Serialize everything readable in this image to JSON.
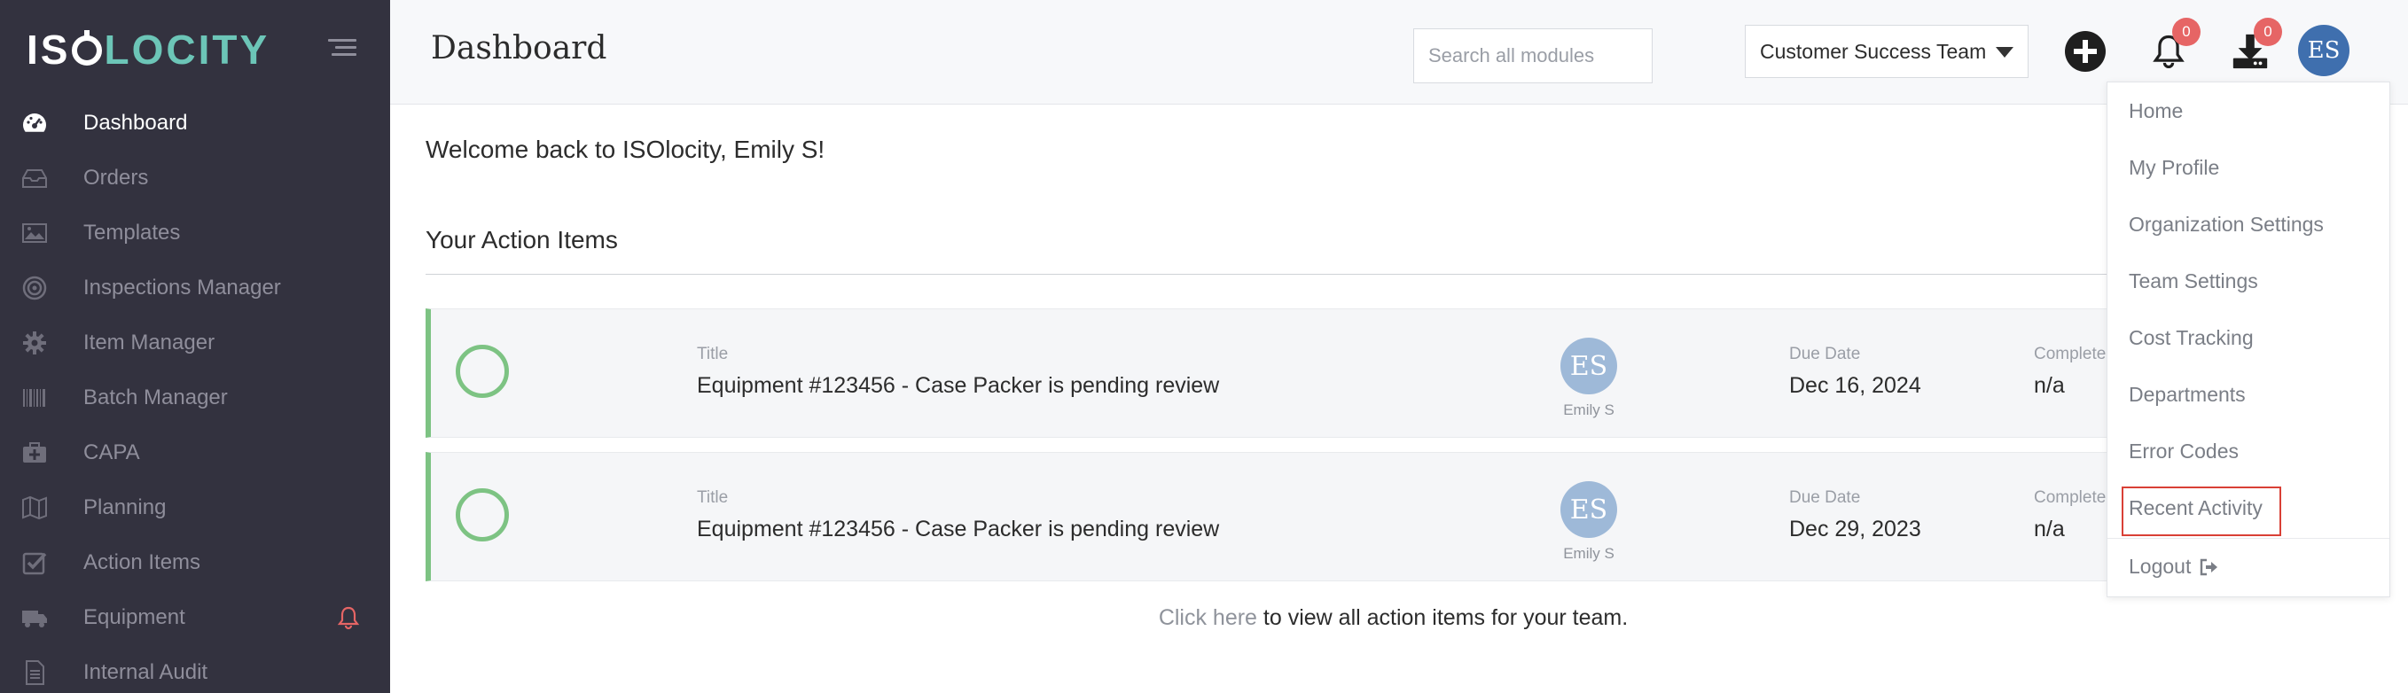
{
  "app": {
    "logo_iso": "IS",
    "logo_locity": "LOCITY"
  },
  "sidebar": {
    "items": [
      {
        "label": "Dashboard",
        "icon": "dashboard-gauge-icon",
        "active": true
      },
      {
        "label": "Orders",
        "icon": "inbox-icon"
      },
      {
        "label": "Templates",
        "icon": "image-icon"
      },
      {
        "label": "Inspections Manager",
        "icon": "target-icon"
      },
      {
        "label": "Item Manager",
        "icon": "gear-icon"
      },
      {
        "label": "Batch Manager",
        "icon": "barcode-icon"
      },
      {
        "label": "CAPA",
        "icon": "medical-kit-icon"
      },
      {
        "label": "Planning",
        "icon": "map-icon"
      },
      {
        "label": "Action Items",
        "icon": "checkbox-icon"
      },
      {
        "label": "Equipment",
        "icon": "truck-icon"
      },
      {
        "label": "Internal Audit",
        "icon": "document-icon"
      }
    ]
  },
  "header": {
    "title": "Dashboard",
    "search_placeholder": "Search all modules",
    "team": "Customer Success Team",
    "notifications_count": "0",
    "downloads_count": "0",
    "avatar_initials": "ES"
  },
  "main": {
    "welcome": "Welcome back to ISOlocity, Emily S!",
    "section_title": "Your Action Items",
    "action_items": [
      {
        "title_label": "Title",
        "title": "Equipment #123456 - Case Packer is pending review",
        "avatar_initials": "ES",
        "assignee": "Emily S",
        "due_label": "Due Date",
        "due": "Dec 16, 2024",
        "completed_label": "Completed Date",
        "completed": "n/a"
      },
      {
        "title_label": "Title",
        "title": "Equipment #123456 - Case Packer is pending review",
        "avatar_initials": "ES",
        "assignee": "Emily S",
        "due_label": "Due Date",
        "due": "Dec 29, 2023",
        "completed_label": "Completed Date",
        "completed": "n/a"
      }
    ],
    "footer_link": "Click here",
    "footer_text": " to view all action items for your team."
  },
  "dropdown": {
    "items": [
      "Home",
      "My Profile",
      "Organization Settings",
      "Team Settings",
      "Cost Tracking",
      "Departments",
      "Error Codes",
      "Recent Activity",
      "Logout"
    ],
    "highlighted": "Recent Activity"
  },
  "colors": {
    "sidebar_bg": "#33323f",
    "accent_teal": "#6cc5b7",
    "success_green": "#7dc383",
    "badge_red": "#e66565",
    "avatar_blue": "#3f6fae",
    "highlight_red": "#d94036"
  }
}
